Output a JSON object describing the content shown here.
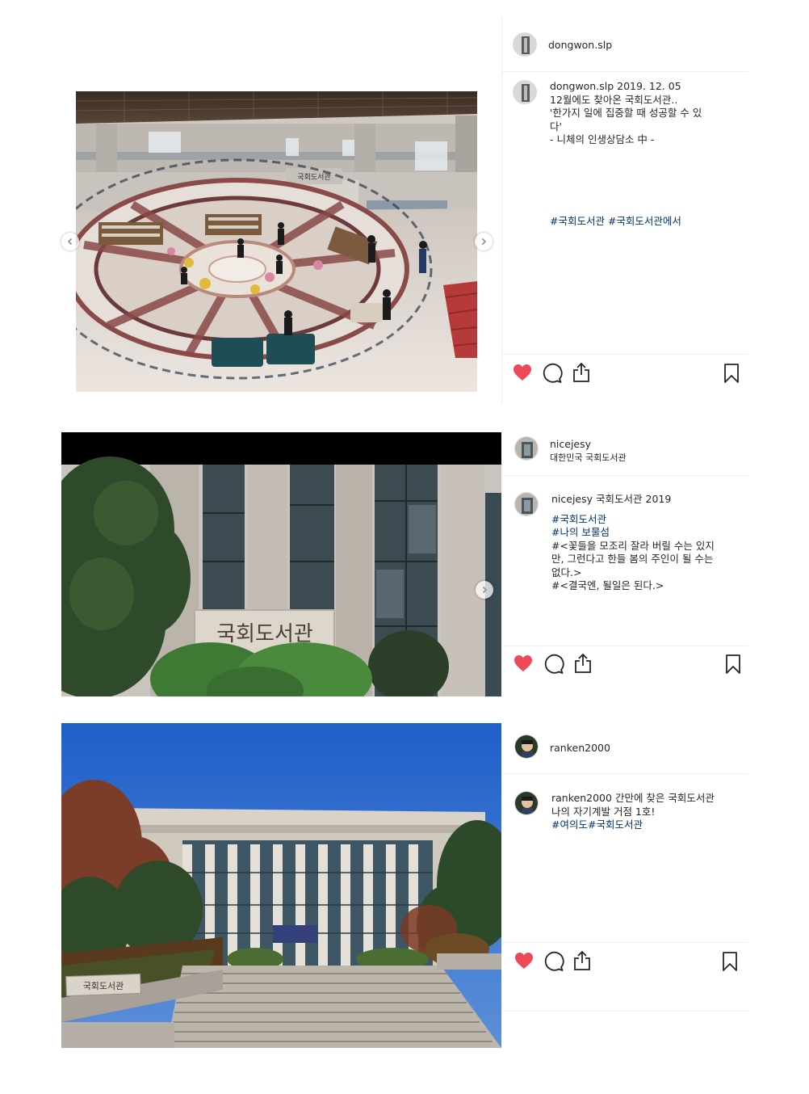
{
  "posts": [
    {
      "username": "dongwon.slp",
      "location": "",
      "caption_lines": [
        {
          "text": "12월에도 찾아온 국회도서관..",
          "type": "text"
        },
        {
          "text": "'한가지 일에 집중할 때 성공할 수 있",
          "type": "text"
        },
        {
          "text": "다'",
          "type": "text"
        },
        {
          "text": "- 니체의 인생상담소 中 -",
          "type": "text"
        }
      ],
      "caption_date": "2019. 12. 05",
      "hashtags": "#국회도서관 #국회도서관에서",
      "photo_sign": "국회도서관",
      "icons": [
        "heart-filled-icon",
        "comment-icon",
        "share-icon",
        "bookmark-icon"
      ],
      "colors": {
        "floor": "#e6ded8",
        "marble_red": "#8a4a48"
      }
    },
    {
      "username": "nicejesy",
      "location": "대한민국 국회도서관",
      "caption_head": "국회도서관 2019",
      "caption_lines": [
        {
          "text": "#국회도서관",
          "type": "tag"
        },
        {
          "text": "#나의 보물섬",
          "type": "tag"
        },
        {
          "text": "#<꽃들을 모조리 잘라 버릴 수는 있지",
          "type": "text"
        },
        {
          "text": "만, 그런다고 한들 봄의 주인이 될 수는",
          "type": "text"
        },
        {
          "text": "없다.>",
          "type": "text"
        },
        {
          "text": "#<결국엔, 될일은 된다.>",
          "type": "text"
        }
      ],
      "photo_sign": "국회도서관",
      "icons": [
        "heart-filled-icon",
        "comment-icon",
        "share-icon",
        "bookmark-icon"
      ]
    },
    {
      "username": "ranken2000",
      "location": "",
      "caption_head": "간만에 찾은 국회도서관",
      "caption_lines": [
        {
          "text": "나의 자기계발 거점 1호!",
          "type": "text"
        },
        {
          "text": "#여의도#국회도서관",
          "type": "tag"
        }
      ],
      "photo_sign": "국회도서관",
      "icons": [
        "heart-filled-icon",
        "comment-icon",
        "share-icon",
        "bookmark-icon"
      ],
      "colors": {
        "sky": "#1f5fc9"
      }
    }
  ],
  "colors": {
    "heart": "#ed4956",
    "tag": "#003569",
    "divider": "#efefef",
    "icon_stroke": "#262626"
  }
}
